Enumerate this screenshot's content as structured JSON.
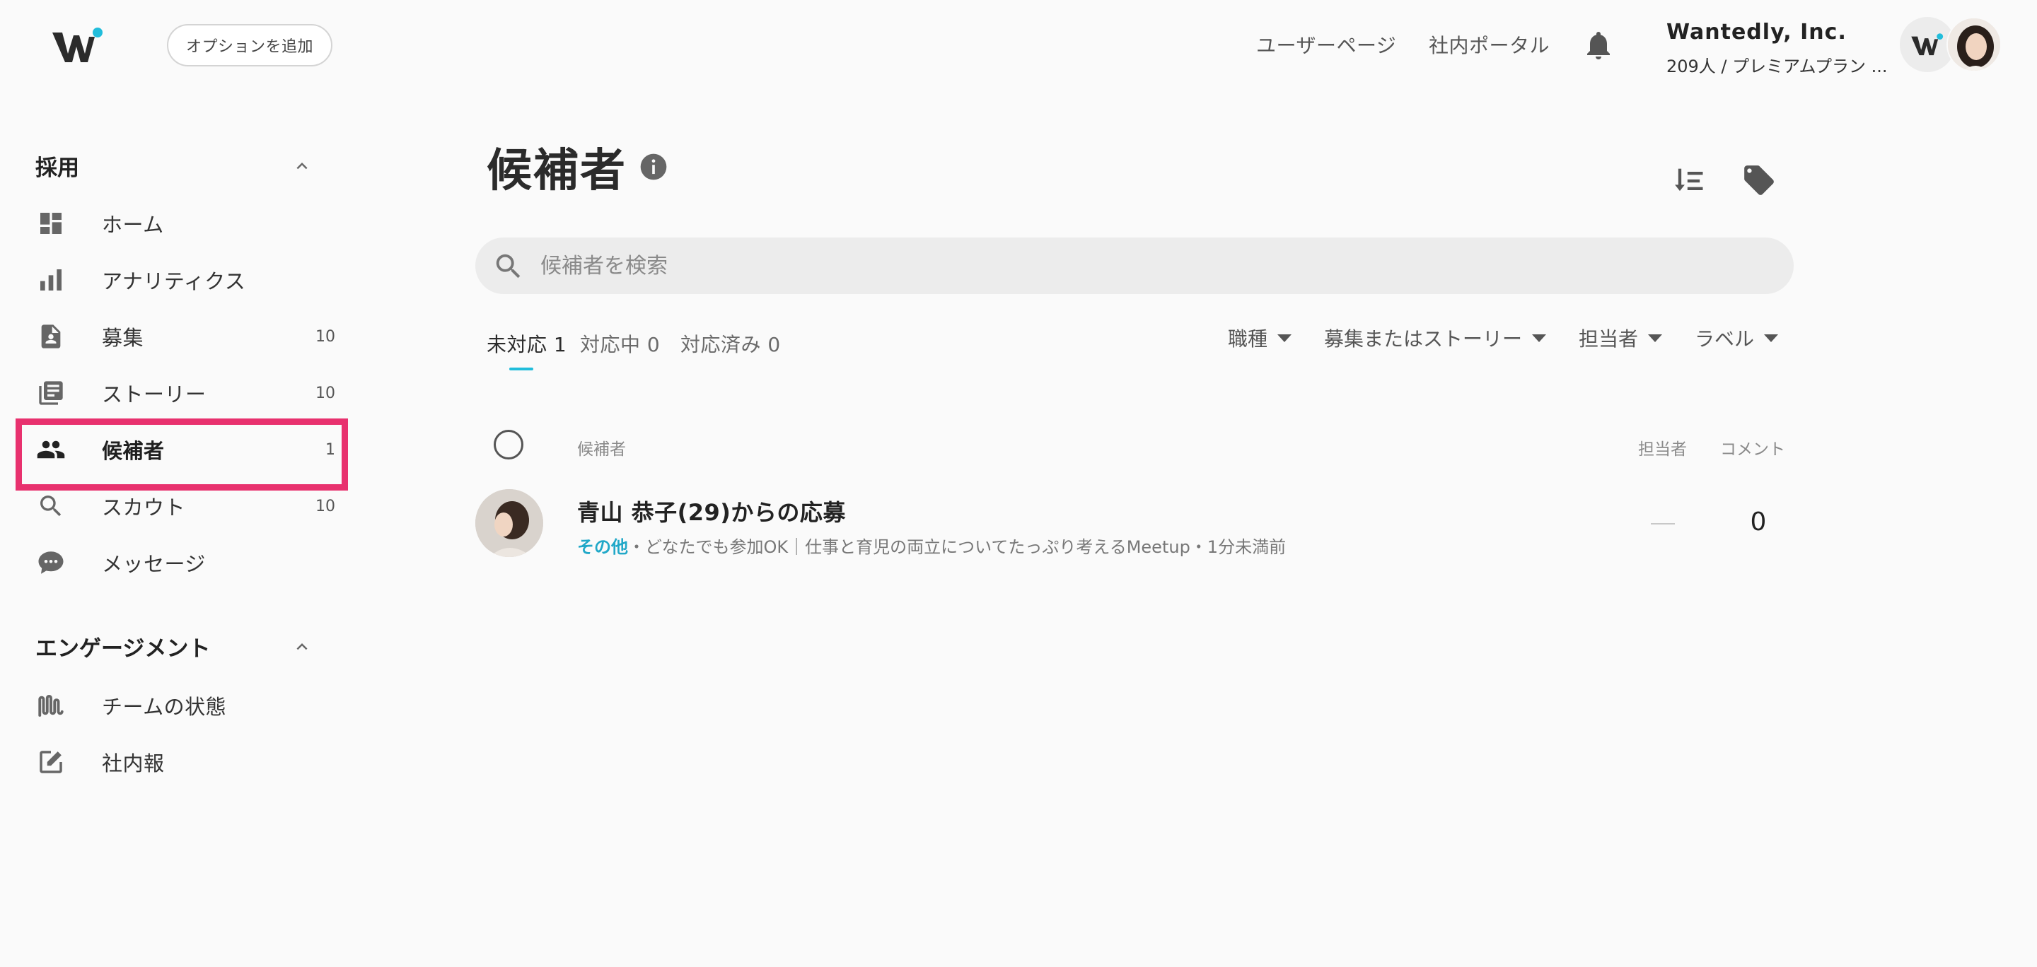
{
  "header": {
    "add_option_label": "オプションを追加",
    "user_page_label": "ユーザーページ",
    "portal_label": "社内ポータル",
    "company_name": "Wantedly, Inc.",
    "company_sub": "209人 / プレミアムプラン ...",
    "brand_color": "#21bddb"
  },
  "sidebar": {
    "recruit_title": "採用",
    "recruit_items": [
      {
        "label": "ホーム",
        "icon": "dashboard-icon",
        "count": ""
      },
      {
        "label": "アナリティクス",
        "icon": "bar-chart-icon",
        "count": ""
      },
      {
        "label": "募集",
        "icon": "job-post-icon",
        "count": "10"
      },
      {
        "label": "ストーリー",
        "icon": "story-icon",
        "count": "10"
      },
      {
        "label": "候補者",
        "icon": "people-icon",
        "count": "1"
      },
      {
        "label": "スカウト",
        "icon": "search-icon",
        "count": "10"
      },
      {
        "label": "メッセージ",
        "icon": "chat-icon",
        "count": ""
      }
    ],
    "engage_title": "エンゲージメント",
    "engage_items": [
      {
        "label": "チームの状態",
        "icon": "wave-icon"
      },
      {
        "label": "社内報",
        "icon": "edit-icon"
      }
    ],
    "highlight_color": "#e8316e"
  },
  "main": {
    "title": "候補者",
    "search_placeholder": "候補者を検索",
    "tabs": [
      {
        "label": "未対応 1",
        "active": true
      },
      {
        "label": "対応中 0",
        "active": false
      },
      {
        "label": "対応済み 0",
        "active": false
      }
    ],
    "filters": [
      "職種",
      "募集またはストーリー",
      "担当者",
      "ラベル"
    ],
    "columns": {
      "candidate": "候補者",
      "assignee": "担当者",
      "comments": "コメント"
    },
    "candidates": [
      {
        "name": "青山 恭子(29)からの応募",
        "category": "その他",
        "detail": "・どなたでも参加OK｜仕事と育児の両立についてたっぷり考えるMeetup・1分未満前",
        "assignee": "",
        "comments": "0"
      }
    ]
  }
}
